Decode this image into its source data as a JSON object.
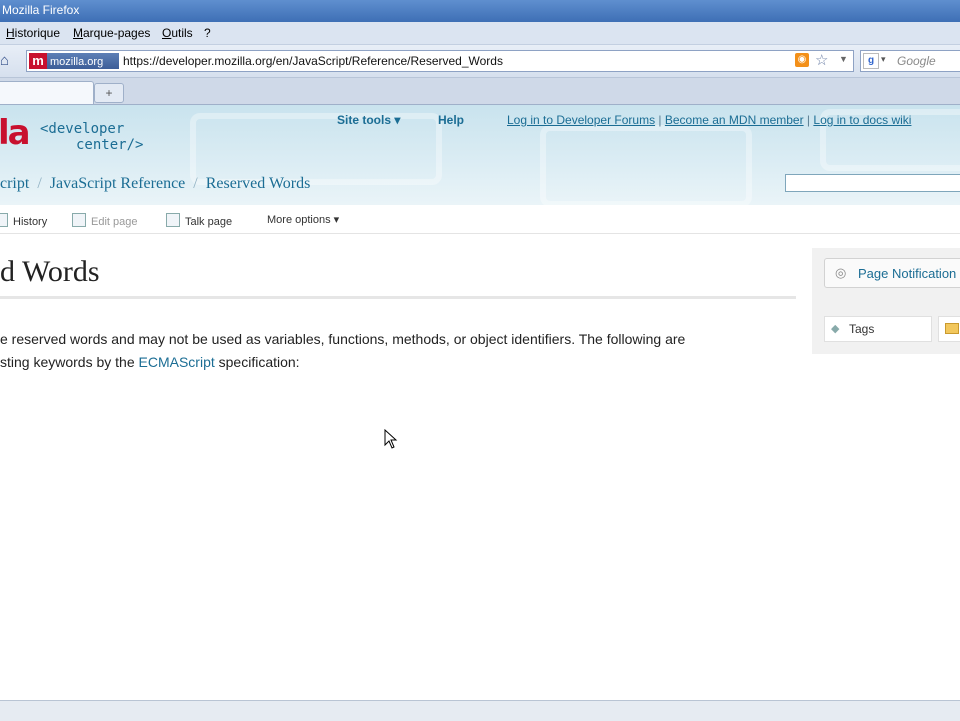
{
  "window": {
    "title": "Mozilla Firefox"
  },
  "menu": [
    "Historique",
    "Marque-pages",
    "Outils",
    "?"
  ],
  "nav": {
    "site_badge_letter": "m",
    "site_badge_domain": "mozilla.org",
    "url": "https://developer.mozilla.org/en/JavaScript/Reference/Reserved_Words",
    "search_engine_icon": "google-g",
    "search_placeholder": "Google"
  },
  "tabs": {
    "active_label": "",
    "new_tab_symbol": "+"
  },
  "header": {
    "logo_fragment": "la",
    "dev_center_line1": "<developer",
    "dev_center_line2": "center/>",
    "site_tools": "Site tools ▾",
    "help": "Help",
    "user_links": [
      "Log in to Developer Forums",
      "Become an MDN member",
      "Log in to docs wiki"
    ],
    "breadcrumb": [
      "cript",
      "JavaScript Reference",
      "Reserved Words"
    ],
    "breadcrumb_sep": "/"
  },
  "page_tools": [
    "History",
    "Edit page",
    "Talk page",
    "More options ▾"
  ],
  "content": {
    "title": "d Words",
    "para_line1": "e reserved words and may not be used as variables, functions, methods, or object identifiers. The following are",
    "para_line2_pre": "sting keywords by the ",
    "para_line2_link": "ECMAScript",
    "para_line2_post": " specification:"
  },
  "sidebar": {
    "notifications": "Page Notification",
    "tags": "Tags"
  },
  "colors": {
    "link": "#1b6d94",
    "brand_red": "#c8102e",
    "header_bg": "#c9e3ee"
  }
}
